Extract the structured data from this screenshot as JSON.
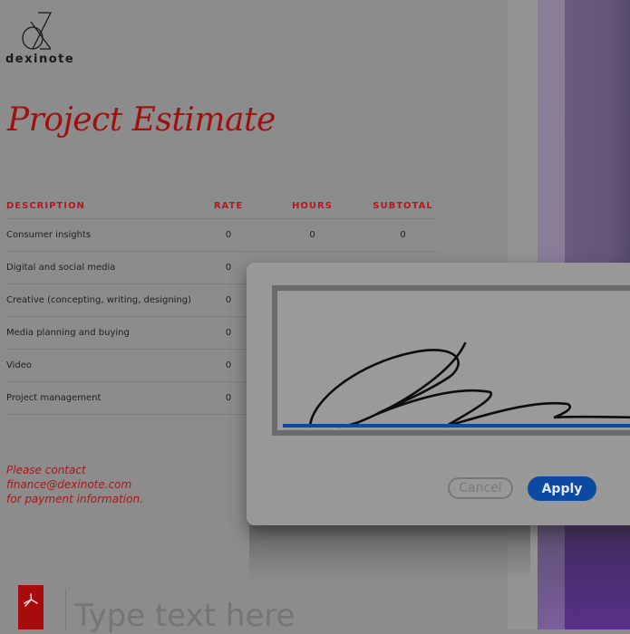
{
  "brand": {
    "name": "dexinote",
    "logo_icon": "dexinote-logo-icon"
  },
  "document": {
    "title": "Project Estimate",
    "table": {
      "headers": [
        "DESCRIPTION",
        "RATE",
        "HOURS",
        "SUBTOTAL"
      ],
      "rows": [
        [
          "Consumer insights",
          "0",
          "0",
          "0"
        ],
        [
          "Digital and social media",
          "0",
          "",
          ""
        ],
        [
          "Creative (concepting, writing, designing)",
          "0",
          "",
          ""
        ],
        [
          "Media planning and buying",
          "0",
          "",
          ""
        ],
        [
          "Video",
          "0",
          "",
          ""
        ],
        [
          "Project management",
          "0",
          "",
          ""
        ]
      ]
    },
    "contact_note": [
      "Please contact",
      "finance@dexinote.com",
      "for payment information."
    ]
  },
  "signature_dialog": {
    "cancel_label": "Cancel",
    "apply_label": "Apply",
    "baseline_color": "#0b4aa0"
  },
  "footer": {
    "app_icon": "acrobat-icon",
    "input_placeholder": "Type text here"
  },
  "colors": {
    "accent_red": "#a01010",
    "apply_blue": "#0b4aa0",
    "purple": "#6a5c7e"
  }
}
